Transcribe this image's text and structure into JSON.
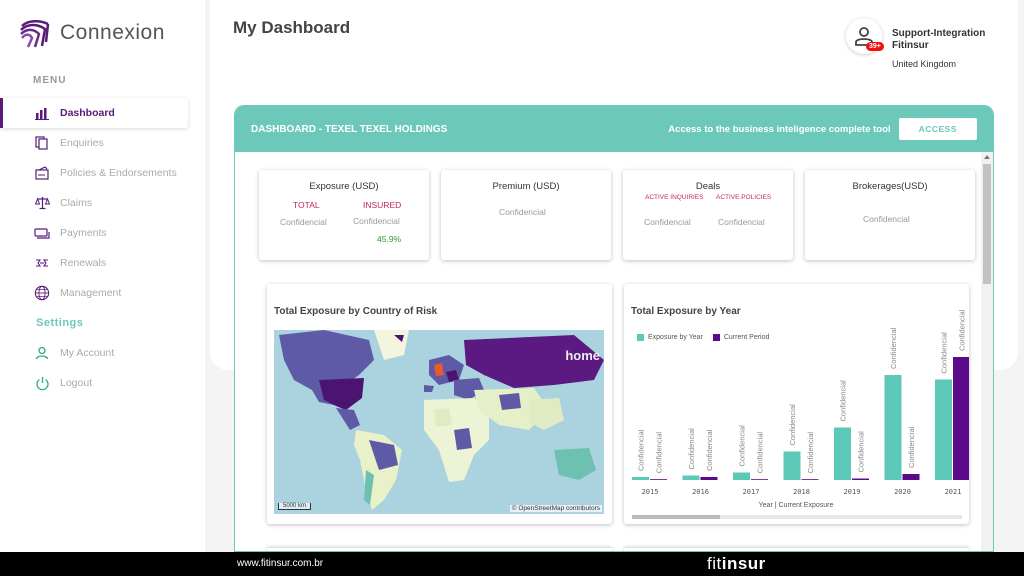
{
  "brand": {
    "name": "Connexion"
  },
  "sidebar": {
    "menu_label": "MENU",
    "items": [
      {
        "label": "Dashboard",
        "icon": "bar-chart-icon",
        "active": true
      },
      {
        "label": "Enquiries",
        "icon": "documents-icon"
      },
      {
        "label": "Policies & Endorsements",
        "icon": "policy-icon"
      },
      {
        "label": "Claims",
        "icon": "scale-icon"
      },
      {
        "label": "Payments",
        "icon": "payment-icon"
      },
      {
        "label": "Renewals",
        "icon": "renewal-icon"
      },
      {
        "label": "Management",
        "icon": "globe-icon"
      }
    ],
    "settings_label": "Settings",
    "settings_items": [
      {
        "label": "My Account",
        "icon": "user-icon"
      },
      {
        "label": "Logout",
        "icon": "power-icon"
      }
    ]
  },
  "header": {
    "title": "My Dashboard",
    "user": {
      "name": "Support-Integration Fitinsur",
      "country": "United Kingdom",
      "badge": "39+"
    }
  },
  "dashboard": {
    "title": "DASHBOARD - TEXEL TEXEL HOLDINGS",
    "access_text": "Access to the business inteligence complete tool",
    "access_button": "ACCESS"
  },
  "kpis": {
    "exposure": {
      "title": "Exposure (USD)",
      "total_label": "TOTAL",
      "insured_label": "INSURED",
      "total_value": "Confidencial",
      "insured_value": "Confidencial",
      "insured_pct": "45.9%"
    },
    "premium": {
      "title": "Premium (USD)",
      "value": "Confidencial"
    },
    "deals": {
      "title": "Deals",
      "inquiries_label": "ACTIVE INQUIRIES",
      "policies_label": "ACTIVE POLICIES",
      "inquiries_value": "Confidencial",
      "policies_value": "Confidencial"
    },
    "brokerages": {
      "title": "Brokerages(USD)",
      "value": "Confidencial"
    }
  },
  "map_card": {
    "title": "Total Exposure by Country of Risk",
    "home_label": "home",
    "scale_label": "5000 km",
    "attribution": "© OpenStreetMap contributors"
  },
  "colors": {
    "accent": "#6cc9b9",
    "brand_purple": "#5a1a7a",
    "series_year": "#5cc8b8",
    "series_current": "#5b0b8a"
  },
  "chart_data": {
    "type": "bar",
    "title": "Total Exposure by Year",
    "xlabel": "Year | Current Exposure",
    "ylabel": "",
    "categories": [
      "2015",
      "2016",
      "2017",
      "2018",
      "2019",
      "2020",
      "2021"
    ],
    "series": [
      {
        "name": "Exposure by Year",
        "values": [
          2,
          3,
          5,
          19,
          35,
          70,
          67
        ],
        "labels": [
          "Confidencial",
          "Confidencial",
          "Confidencial",
          "Confidencial",
          "Confidencial",
          "Confidencial",
          "Confidencial"
        ]
      },
      {
        "name": "Current Period",
        "values": [
          0,
          2,
          0,
          0,
          1,
          4,
          82
        ],
        "labels": [
          "Confidencial",
          "Confidencial",
          "Confidencial",
          "Confidencial",
          "Confidencial",
          "Confidencial",
          "Confidencial"
        ]
      }
    ],
    "ylim": [
      0,
      100
    ],
    "grid": false,
    "legend": "top-left"
  }
}
